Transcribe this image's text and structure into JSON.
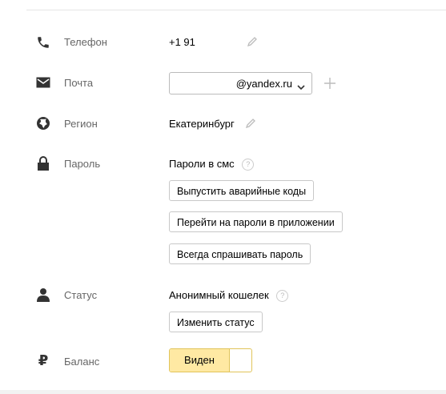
{
  "phone": {
    "label": "Телефон",
    "value": "+1 91"
  },
  "email": {
    "label": "Почта",
    "suffix": "@yandex.ru"
  },
  "region": {
    "label": "Регион",
    "value": "Екатеринбург"
  },
  "password": {
    "label": "Пароль",
    "sms_text": "Пароли в смс",
    "help": "?",
    "buttons": [
      "Выпустить аварийные коды",
      "Перейти на пароли в приложении",
      "Всегда спрашивать пароль"
    ]
  },
  "status": {
    "label": "Статус",
    "value": "Анонимный кошелек",
    "help": "?",
    "change_button": "Изменить статус"
  },
  "balance": {
    "label": "Баланс",
    "toggle_label": "Виден",
    "toggle_state": "on"
  },
  "colors": {
    "toggle_bg": "#ffe9a3",
    "toggle_border": "#e1c45a",
    "icon": "#333333"
  }
}
